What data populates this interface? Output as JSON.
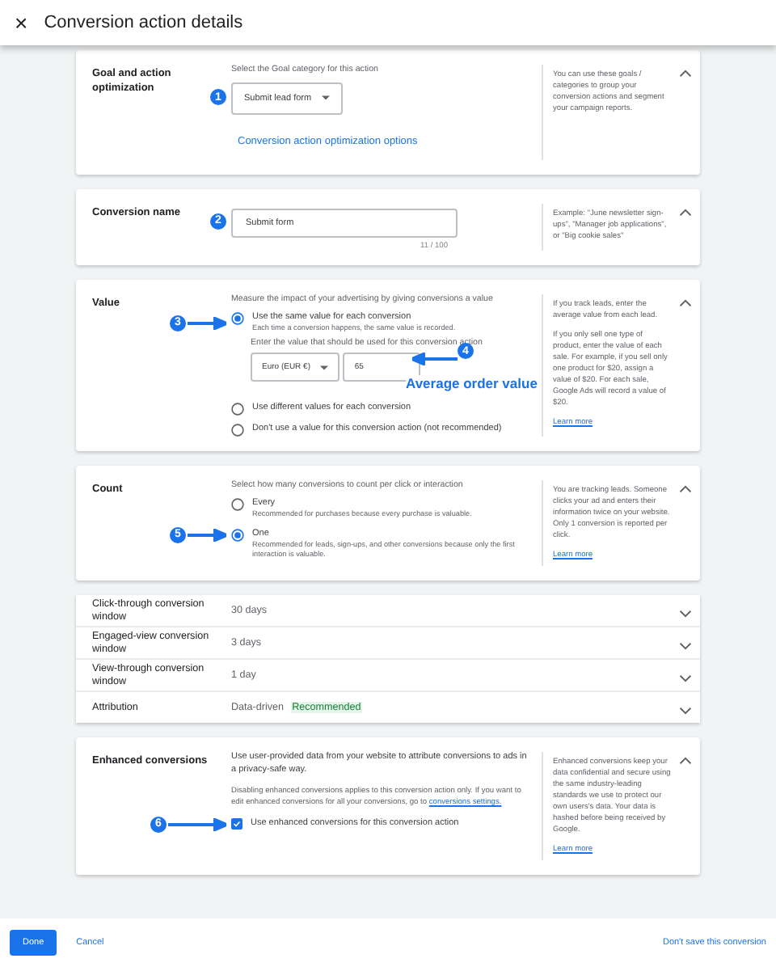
{
  "window": {
    "title": "Conversion action details",
    "close": "×"
  },
  "goal": {
    "label": "Goal and action optimization",
    "expanded": true,
    "hint": "Select the Goal category for this action",
    "dropdown": "Submit lead form",
    "link": "Conversion action optimization options",
    "side": "You can use these goals / categories to group your conversion actions and segment your campaign reports.",
    "step": "1"
  },
  "name": {
    "label": "Conversion name",
    "expanded": true,
    "value": "Submit form",
    "counter": "11 / 100",
    "side": "Example: \"June newsletter sign-ups\", \"Manager job applications\", or \"Big cookie sales\"",
    "step": "2"
  },
  "value": {
    "label": "Value",
    "expanded": true,
    "hint": "Measure the impact of your advertising by giving conversions a value",
    "options": [
      {
        "label": "Use the same value for each conversion",
        "description": "Each time a conversion happens, the same value is recorded.",
        "selected": true
      },
      {
        "label": "Use different values for each conversion",
        "selected": false
      },
      {
        "label": "Don't use a value for this conversion action (not recommended)",
        "selected": false
      }
    ],
    "prompt": "Enter the value that should be used for this conversion action",
    "currency": "Euro (EUR €)",
    "amount": "65",
    "callout": "Average order value",
    "side": [
      "If you track leads, enter the average value from each lead.",
      "If you only sell one type of product, enter the value of each sale. For example, if you sell only one product for $20, assign a value of $20. For each sale, Google Ads will record a value of $20."
    ],
    "learn_more": "Learn more",
    "steps": [
      "3",
      "4"
    ]
  },
  "count": {
    "label": "Count",
    "expanded": true,
    "hint": "Select how many conversions to count per click or interaction",
    "options": [
      {
        "label": "Every",
        "description": "Recommended for purchases because every purchase is valuable.",
        "selected": false
      },
      {
        "label": "One",
        "description": "Recommended for leads, sign-ups, and other conversions because only the first interaction is valuable.",
        "selected": true
      }
    ],
    "side": "You are tracking leads. Someone clicks your ad and enters their information twice on your website. Only 1 conversion is reported per click.",
    "learn_more": "Learn more",
    "step": "5"
  },
  "settings": [
    {
      "label": "Click-through conversion window",
      "value": "30 days",
      "expanded": false
    },
    {
      "label": "Engaged-view conversion window",
      "value": "3 days",
      "expanded": false
    },
    {
      "label": "View-through conversion window",
      "value": "1 day",
      "expanded": false
    },
    {
      "label": "Attribution",
      "value": "Data-driven",
      "tag": "Recommended",
      "expanded": false
    }
  ],
  "enhanced": {
    "label": "Enhanced conversions",
    "expanded": true,
    "text": "Use user-provided data from your website to attribute conversions to ads in a privacy-safe way.",
    "note": "Disabling enhanced conversions applies to this conversion action only. If you want to edit enhanced conversions for all your conversions, go to",
    "note_link": "conversions settings.",
    "checkbox": {
      "label": "Use enhanced conversions for this conversion action",
      "checked": true
    },
    "side": "Enhanced conversions keep your data confidential and secure using the same industry-leading standards we use to protect our own users's data. Your data is hashed before being received by Google.",
    "learn_more": "Learn more",
    "step": "6"
  },
  "footer": {
    "done": "Done",
    "cancel": "Cancel",
    "discard": "Don't save this conversion"
  }
}
